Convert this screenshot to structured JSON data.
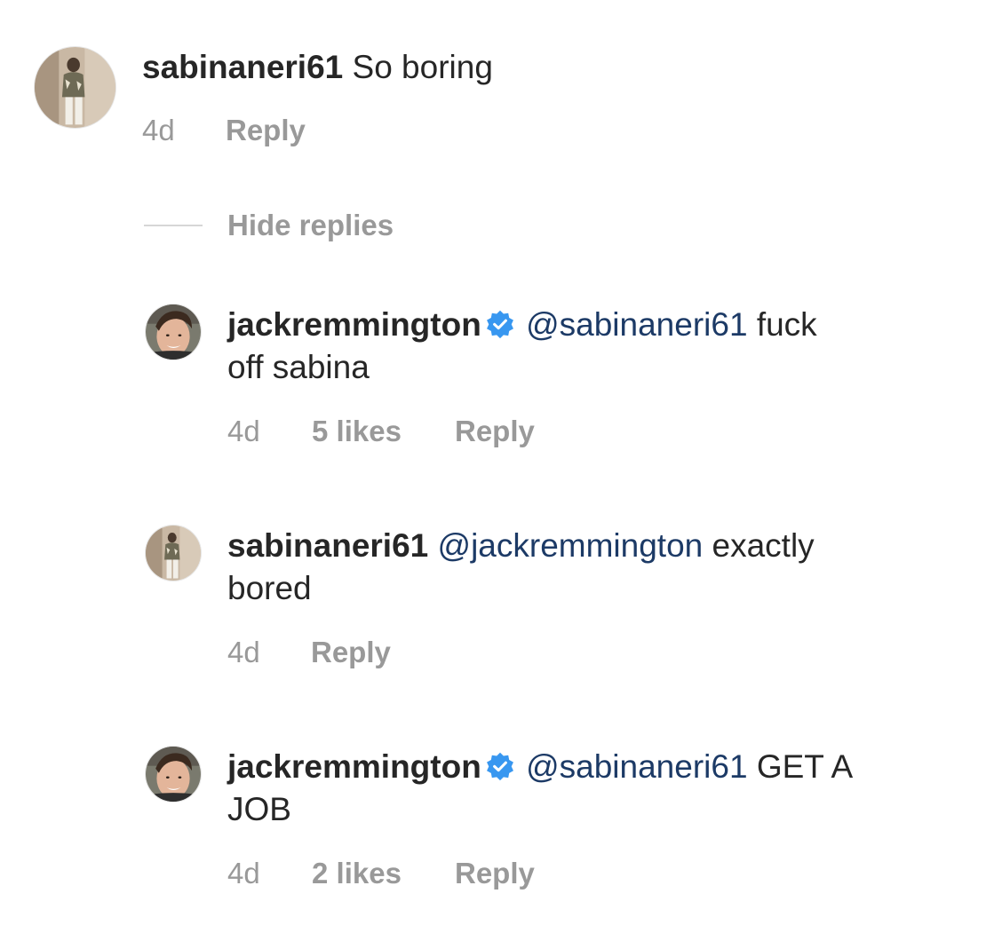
{
  "comments": [
    {
      "username": "sabinaneri61",
      "verified": false,
      "mention": "",
      "text": "So boring",
      "text2": "",
      "time": "4d",
      "likes": "",
      "reply": "Reply"
    },
    {
      "username": "jackremmington",
      "verified": true,
      "mention": "@sabinaneri61",
      "text": "fuck",
      "text2": "off sabina",
      "time": "4d",
      "likes": "5 likes",
      "reply": "Reply"
    },
    {
      "username": "sabinaneri61",
      "verified": false,
      "mention": "@jackremmington",
      "text": "exactly",
      "text2": "bored",
      "time": "4d",
      "likes": "",
      "reply": "Reply"
    },
    {
      "username": "jackremmington",
      "verified": true,
      "mention": "@sabinaneri61",
      "text": "GET A",
      "text2": "JOB",
      "time": "4d",
      "likes": "2 likes",
      "reply": "Reply"
    }
  ],
  "hide_replies": "Hide replies",
  "colors": {
    "text": "#262626",
    "meta": "#999999",
    "mention": "#1c3a66",
    "verified": "#3897f0"
  }
}
